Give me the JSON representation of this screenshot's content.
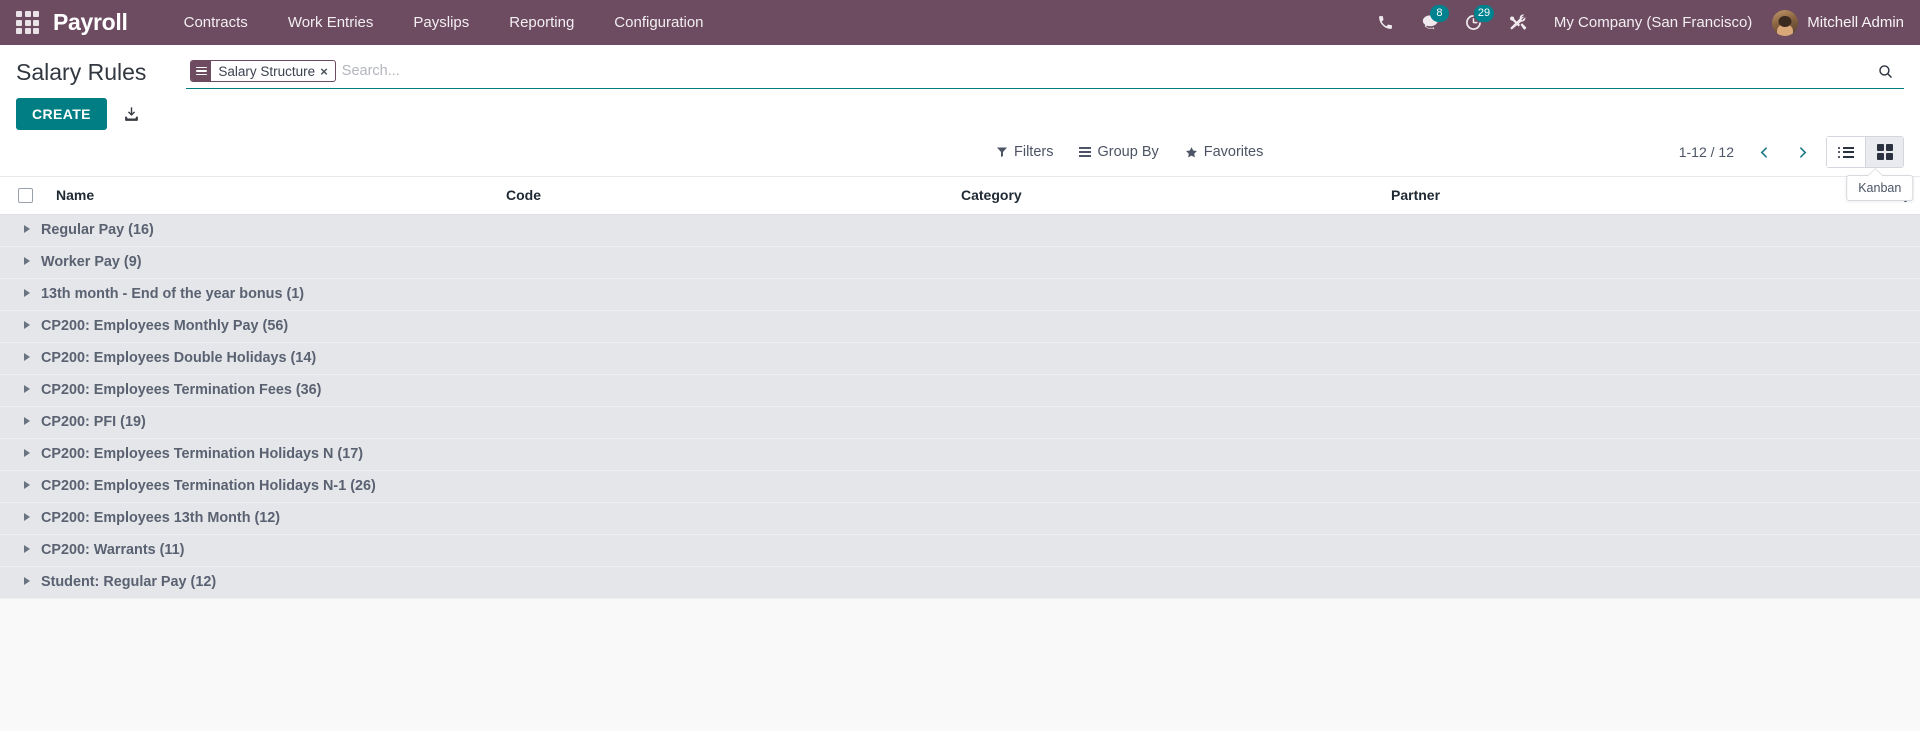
{
  "navbar": {
    "apps_icon": "apps-grid-icon",
    "brand": "Payroll",
    "menu": [
      {
        "label": "Contracts"
      },
      {
        "label": "Work Entries"
      },
      {
        "label": "Payslips"
      },
      {
        "label": "Reporting"
      },
      {
        "label": "Configuration"
      }
    ],
    "systray": {
      "phone_icon": "phone-icon",
      "messages_icon": "chat-bubbles-icon",
      "messages_count": "8",
      "activities_icon": "clock-activity-icon",
      "activities_count": "29",
      "tools_icon": "wrench-screwdriver-icon"
    },
    "company": "My Company (San Francisco)",
    "user": "Mitchell Admin",
    "avatar_icon": "user-avatar"
  },
  "control_panel": {
    "title": "Salary Rules",
    "create_label": "CREATE",
    "import_icon": "import-download-icon",
    "search": {
      "facet": {
        "icon": "group-by-list-icon",
        "label": "Salary Structure",
        "close": "×"
      },
      "placeholder": "Search...",
      "value": "",
      "magnifier_icon": "search-icon"
    },
    "dropdowns": [
      {
        "label": "Filters",
        "icon": "filter-funnel-icon"
      },
      {
        "label": "Group By",
        "icon": "group-by-bars-icon"
      },
      {
        "label": "Favorites",
        "icon": "star-icon"
      }
    ],
    "pager": "1-12 / 12",
    "prev_icon": "chevron-left-icon",
    "next_icon": "chevron-right-icon",
    "views": [
      {
        "name": "list",
        "icon": "list-view-icon",
        "active": false
      },
      {
        "name": "kanban",
        "icon": "kanban-view-icon",
        "active": true
      }
    ],
    "tooltip": "Kanban"
  },
  "list": {
    "columns": [
      "Name",
      "Code",
      "Category",
      "Partner"
    ],
    "groups": [
      {
        "label": "Regular Pay (16)"
      },
      {
        "label": "Worker Pay (9)"
      },
      {
        "label": "13th month - End of the year bonus (1)"
      },
      {
        "label": "CP200: Employees Monthly Pay (56)"
      },
      {
        "label": "CP200: Employees Double Holidays (14)"
      },
      {
        "label": "CP200: Employees Termination Fees (36)"
      },
      {
        "label": "CP200: PFI (19)"
      },
      {
        "label": "CP200: Employees Termination Holidays N (17)"
      },
      {
        "label": "CP200: Employees Termination Holidays N-1 (26)"
      },
      {
        "label": "CP200: Employees 13th Month (12)"
      },
      {
        "label": "CP200: Warrants (11)"
      },
      {
        "label": "Student: Regular Pay (12)"
      }
    ]
  },
  "colors": {
    "navbar": "#6d4c61",
    "accent_teal": "#017e84",
    "badge": "#00838f",
    "group_row": "#e4e6e9"
  }
}
